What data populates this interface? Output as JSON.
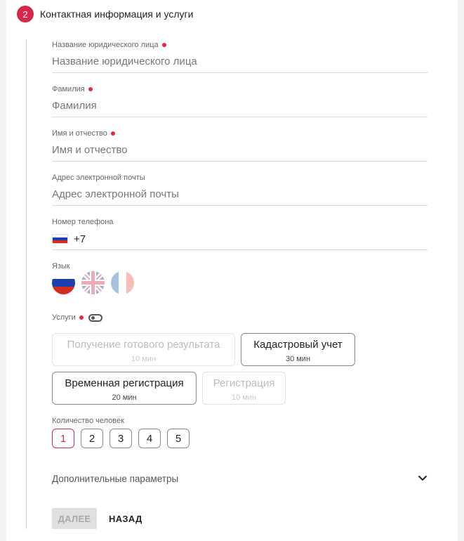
{
  "step": {
    "number": "2",
    "title": "Контактная информация и услуги"
  },
  "fields": {
    "legal_name": {
      "label": "Название юридического лица",
      "placeholder": "Название юридического лица",
      "required": true
    },
    "last_name": {
      "label": "Фамилия",
      "placeholder": "Фамилия",
      "required": true
    },
    "first_name": {
      "label": "Имя и отчество",
      "placeholder": "Имя и отчество",
      "required": true
    },
    "email": {
      "label": "Адрес электронной почты",
      "placeholder": "Адрес электронной почты",
      "required": false
    },
    "phone": {
      "label": "Номер телефона",
      "code": "+7",
      "flag": "russia-flag-icon"
    }
  },
  "language": {
    "label": "Язык",
    "options": [
      {
        "name": "russian",
        "icon": "russia-flag-icon",
        "selected": true
      },
      {
        "name": "english",
        "icon": "uk-flag-icon",
        "selected": false
      },
      {
        "name": "french",
        "icon": "france-flag-icon",
        "selected": false
      }
    ]
  },
  "services": {
    "label": "Услуги",
    "required": true,
    "toggle": "toggle-icon",
    "items": [
      {
        "name": "Получение готового результата",
        "time": "10 мин",
        "enabled": false
      },
      {
        "name": "Кадастровый учет",
        "time": "30 мин",
        "enabled": true
      },
      {
        "name": "Временная регистрация",
        "time": "20 мин",
        "enabled": true
      },
      {
        "name": "Регистрация",
        "time": "10 мин",
        "enabled": false
      }
    ]
  },
  "people_count": {
    "label": "Количество человек",
    "options": [
      "1",
      "2",
      "3",
      "4",
      "5"
    ],
    "selected": "1"
  },
  "advanced": {
    "label": "Дополнительные параметры",
    "icon": "chevron-down-icon"
  },
  "actions": {
    "next_label": "ДАЛЕЕ",
    "back_label": "НАЗАД"
  },
  "colors": {
    "accent": "#d4294b",
    "required_dot": "#e6293f",
    "disabled_button": "#e0e0e0"
  }
}
